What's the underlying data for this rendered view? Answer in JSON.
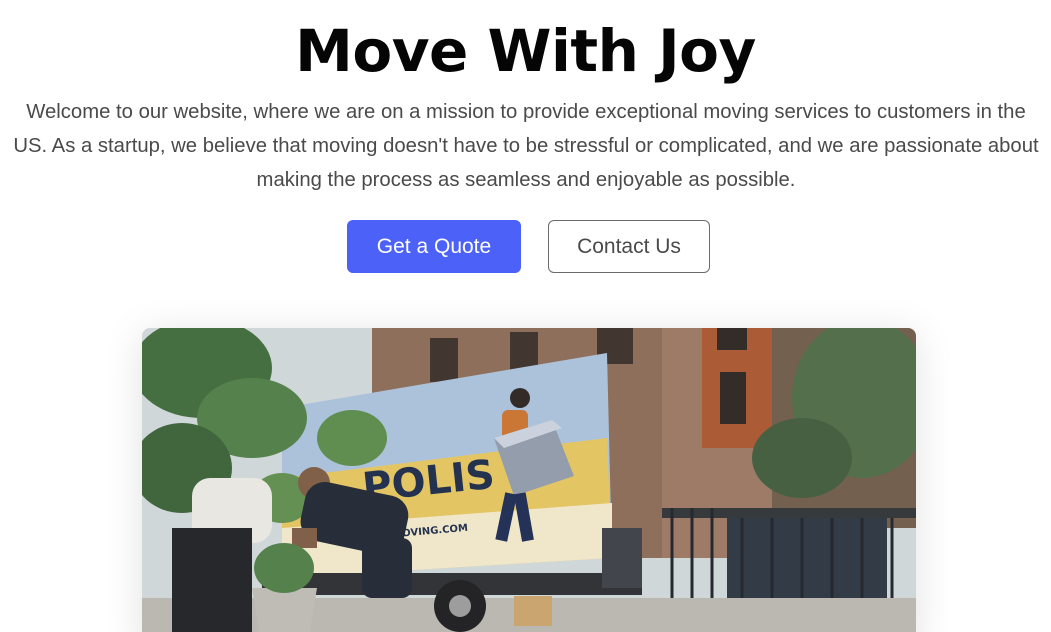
{
  "hero": {
    "title": "Move With Joy",
    "description": "Welcome to our website, where we are on a mission to provide exceptional moving services to customers in the US. As a startup, we believe that moving doesn't have to be stressful or complicated, and we are passionate about making the process as seamless and enjoyable as possible.",
    "primary_button": "Get a Quote",
    "secondary_button": "Contact Us"
  },
  "photo": {
    "truck_lettering": "POLIS",
    "truck_url": "MOVING.COM"
  },
  "colors": {
    "primary": "#4b61f7",
    "title": "#050505",
    "body_text": "#4a4a4a",
    "outline": "#6b6b6b"
  }
}
